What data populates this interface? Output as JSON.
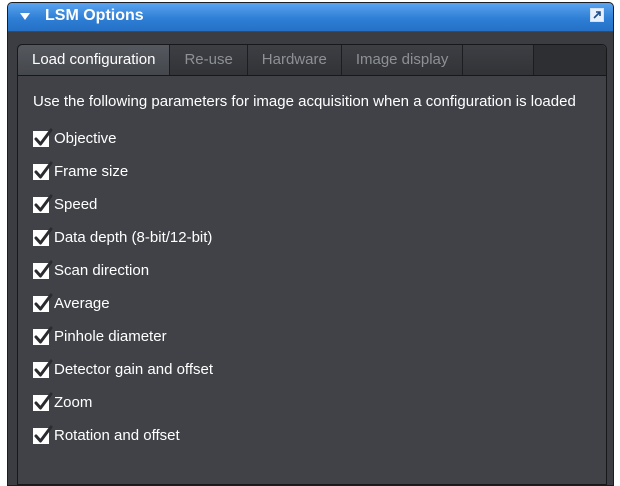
{
  "panel": {
    "title": "LSM Options",
    "icons": {
      "collapse": "triangle-down-icon",
      "undock": "undock-arrow-icon"
    }
  },
  "tabs": [
    {
      "label": "Load configuration",
      "active": true
    },
    {
      "label": "Re-use",
      "active": false
    },
    {
      "label": "Hardware",
      "active": false
    },
    {
      "label": "Image display",
      "active": false
    }
  ],
  "content": {
    "description": "Use the following parameters for image acquisition when a configuration is loaded",
    "options": [
      {
        "label": "Objective",
        "checked": true
      },
      {
        "label": "Frame size",
        "checked": true
      },
      {
        "label": "Speed",
        "checked": true
      },
      {
        "label": "Data depth (8-bit/12-bit)",
        "checked": true
      },
      {
        "label": "Scan direction",
        "checked": true
      },
      {
        "label": "Average",
        "checked": true
      },
      {
        "label": "Pinhole diameter",
        "checked": true
      },
      {
        "label": "Detector gain and offset",
        "checked": true
      },
      {
        "label": "Zoom",
        "checked": true
      },
      {
        "label": "Rotation and offset",
        "checked": true
      }
    ]
  },
  "colors": {
    "title_bar": "#2f7fd6",
    "panel_bg": "#3b3d42",
    "active_tab": "#4e5157",
    "inactive_tab_text": "#8d9095",
    "text": "#ffffff"
  }
}
